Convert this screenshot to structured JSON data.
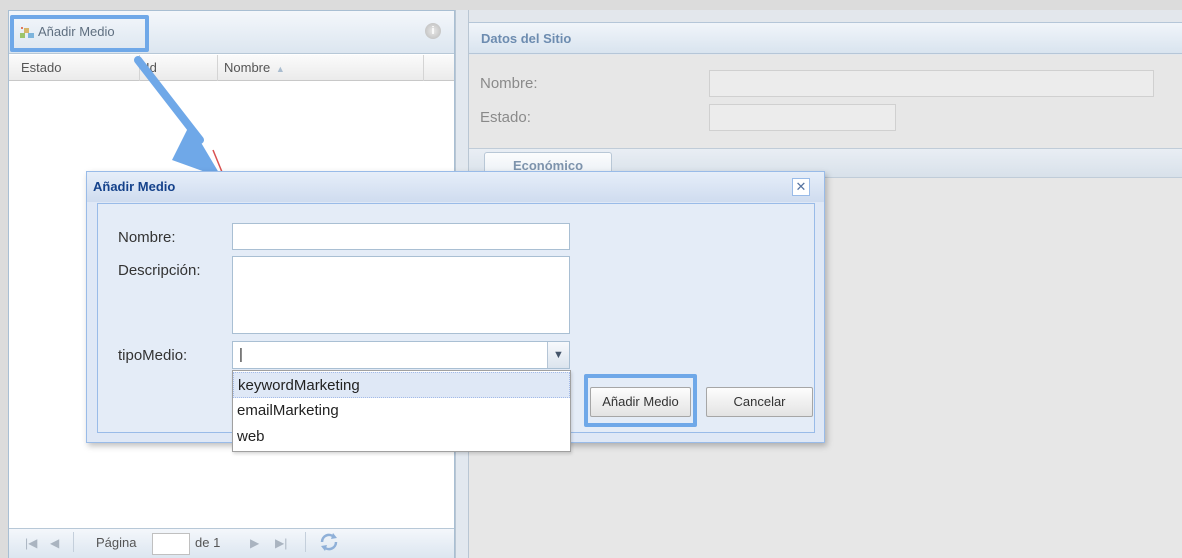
{
  "left_panel": {
    "toolbar": {
      "add_button_label": "Añadir Medio"
    },
    "columns": [
      "Estado",
      "Id",
      "Nombre"
    ],
    "sort_indicator": "▲",
    "pager": {
      "page_label": "Página",
      "of_label": "de 1"
    }
  },
  "right_panel": {
    "title": "Datos del Sitio",
    "fields": [
      {
        "label": "Nombre:"
      },
      {
        "label": "Estado:"
      }
    ],
    "tabs": [
      "Económico"
    ]
  },
  "dialog": {
    "title": "Añadir Medio",
    "close_glyph": "✕",
    "fields": {
      "nombre_label": "Nombre:",
      "descripcion_label": "Descripción:",
      "tipo_label": "tipoMedio:",
      "tipo_value": "|"
    },
    "dropdown_options": [
      "keywordMarketing",
      "emailMarketing",
      "web"
    ],
    "selected_option_index": 0,
    "buttons": {
      "submit": "Añadir Medio",
      "cancel": "Cancelar"
    }
  },
  "colors": {
    "highlight": "#6fa8e8",
    "dialog_title": "#15428b",
    "panel_border": "#99bbe8"
  },
  "icons": {
    "add": "add-media-icon",
    "info": "info-icon",
    "close": "close-icon",
    "combo": "chevron-down-icon",
    "refresh": "refresh-icon"
  }
}
